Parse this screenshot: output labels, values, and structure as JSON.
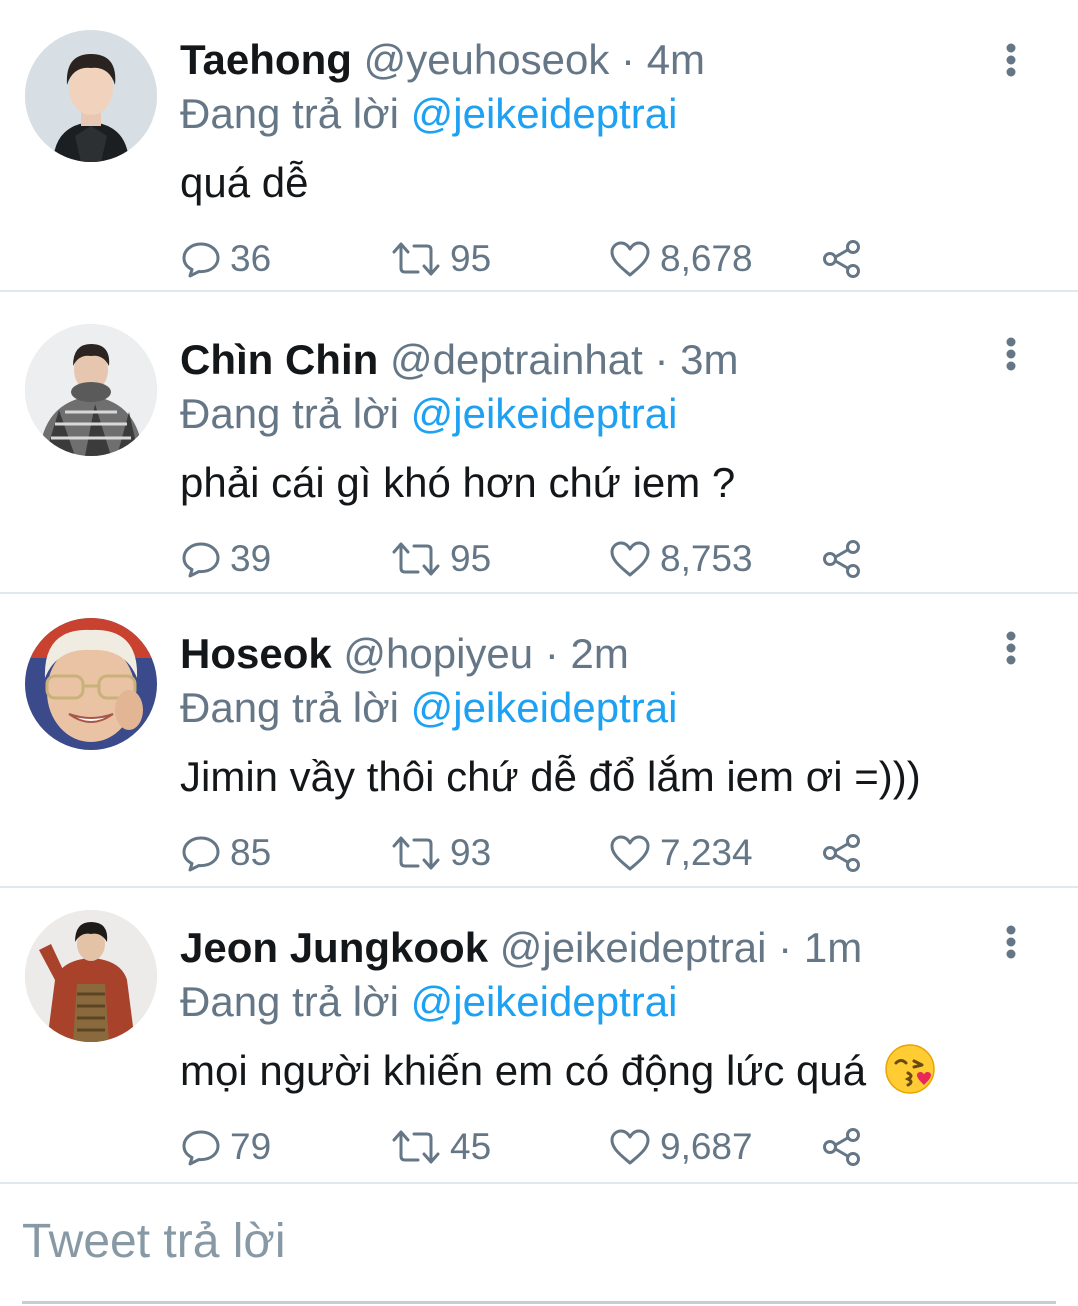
{
  "colors": {
    "accent": "#1da1f2",
    "secondary_text": "#657786",
    "primary_text": "#14171a",
    "divider": "#e1e8ed"
  },
  "tweets": [
    {
      "name": "Taehong",
      "handle": "@yeuhoseok",
      "separator": "·",
      "time": "4m",
      "replying_prefix": "Đang trả lời",
      "replying_to": "@jeikeideptrai",
      "text": "quá dễ",
      "replies": "36",
      "retweets": "95",
      "likes": "8,678"
    },
    {
      "name": "Chìn Chin",
      "handle": "@deptrainhat",
      "separator": "·",
      "time": "3m",
      "replying_prefix": "Đang trả lời",
      "replying_to": "@jeikeideptrai",
      "text": "phải cái gì khó hơn chứ iem ?",
      "replies": "39",
      "retweets": "95",
      "likes": "8,753"
    },
    {
      "name": "Hoseok",
      "handle": "@hopiyeu",
      "separator": "·",
      "time": "2m",
      "replying_prefix": "Đang trả lời",
      "replying_to": "@jeikeideptrai",
      "text": "Jimin vầy thôi chứ dễ đổ lắm iem ơi =)))",
      "replies": "85",
      "retweets": "93",
      "likes": "7,234"
    },
    {
      "name": "Jeon Jungkook",
      "handle": "@jeikeideptrai",
      "separator": "·",
      "time": "1m",
      "replying_prefix": "Đang trả lời",
      "replying_to": "@jeikeideptrai",
      "text": "mọi người khiến em có động lức quá",
      "replies": "79",
      "retweets": "45",
      "likes": "9,687"
    }
  ],
  "compose": {
    "placeholder": "Tweet trả lời"
  }
}
